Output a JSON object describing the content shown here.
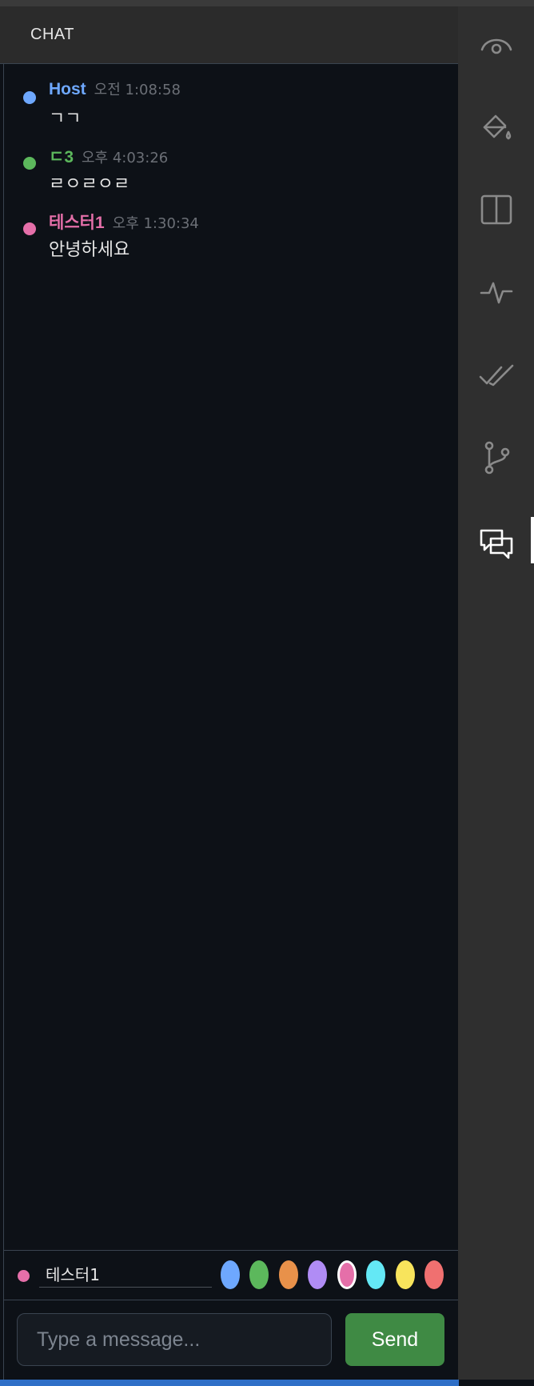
{
  "header": {
    "title": "CHAT"
  },
  "colors": {
    "host": "#6ea8fe",
    "d3": "#5cb85c",
    "tester": "#e56fa9",
    "send": "#3f8a44",
    "time": "#6b6f76"
  },
  "messages": [
    {
      "user": "Host",
      "time": "오전 1:08:58",
      "text": "ㄱㄱ",
      "color": "#6ea8fe"
    },
    {
      "user": "ㄷ3",
      "time": "오후 4:03:26",
      "text": "ㄹㅇㄹㅇㄹ",
      "color": "#5cb85c"
    },
    {
      "user": "테스터1",
      "time": "오후 1:30:34",
      "text": "안녕하세요",
      "color": "#e56fa9"
    }
  ],
  "namebar": {
    "name_value": "테스터1",
    "selected_color": "pink",
    "swatches": [
      "#6ea8fe",
      "#5cb85c",
      "#e8914a",
      "#b08cf5",
      "#e56fa9",
      "#64e8f5",
      "#f8e45c",
      "#f07070"
    ]
  },
  "composer": {
    "placeholder": "Type a message...",
    "send_label": "Send"
  },
  "activity_bar": {
    "items": [
      "eye-icon",
      "paint-bucket-icon",
      "split-view-icon",
      "pulse-icon",
      "double-check-icon",
      "git-branch-icon",
      "chat-icon"
    ],
    "active": "chat-icon"
  }
}
